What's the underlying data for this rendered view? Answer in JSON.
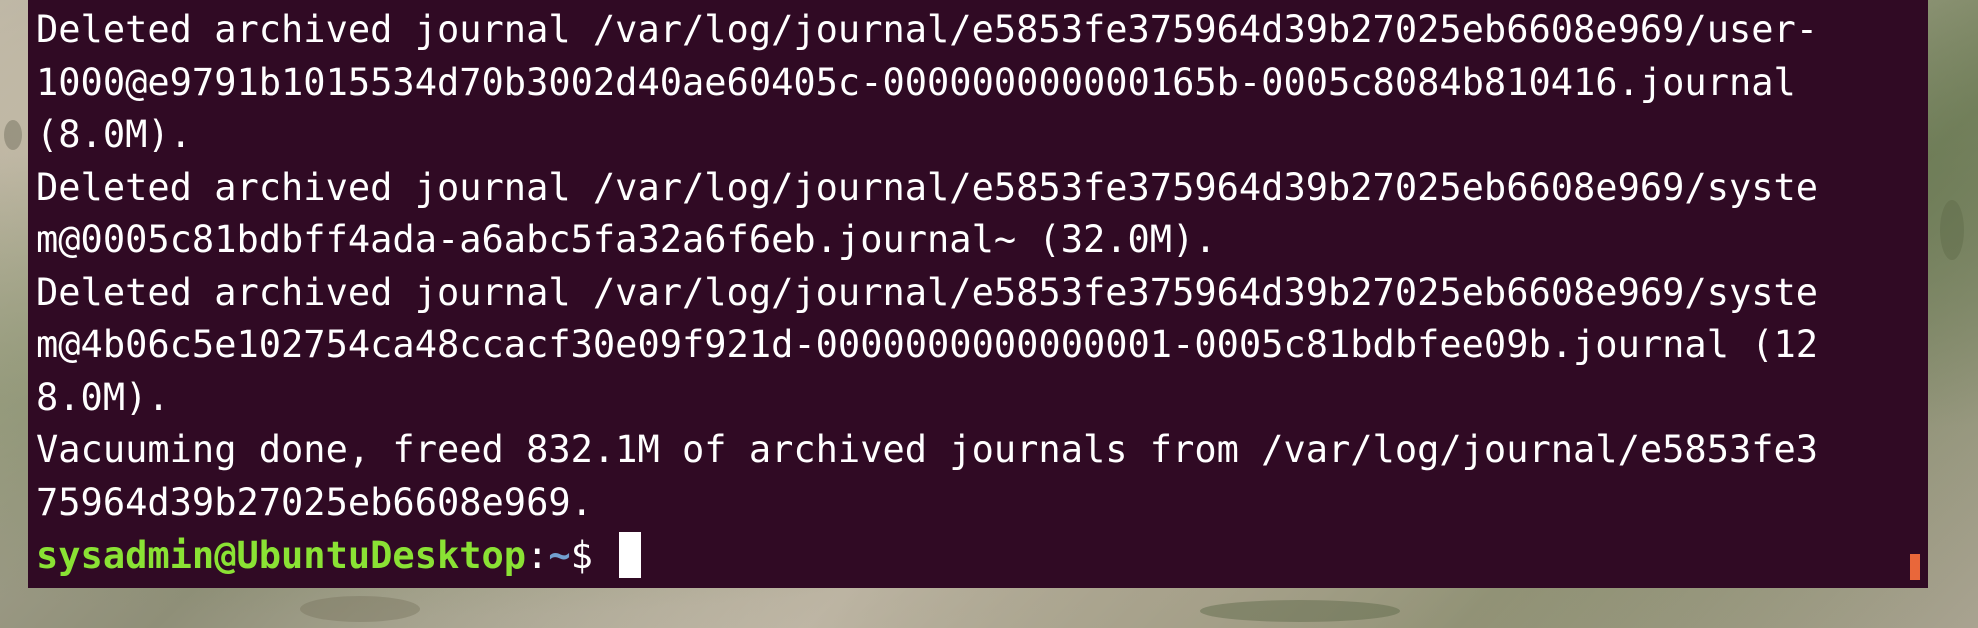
{
  "terminal": {
    "lines": [
      "Deleted archived journal /var/log/journal/e5853fe375964d39b27025eb6608e969/user-",
      "1000@e9791b1015534d70b3002d40ae60405c-000000000000165b-0005c8084b810416.journal",
      "(8.0M).",
      "Deleted archived journal /var/log/journal/e5853fe375964d39b27025eb6608e969/syste",
      "m@0005c81bdbff4ada-a6abc5fa32a6f6eb.journal~ (32.0M).",
      "Deleted archived journal /var/log/journal/e5853fe375964d39b27025eb6608e969/syste",
      "m@4b06c5e102754ca48ccacf30e09f921d-0000000000000001-0005c81bdbfee09b.journal (12",
      "8.0M).",
      "Vacuuming done, freed 832.1M of archived journals from /var/log/journal/e5853fe3",
      "75964d39b27025eb6608e969."
    ],
    "prompt": {
      "user_host": "sysadmin@UbuntuDesktop",
      "separator": ":",
      "path": "~",
      "symbol": "$ "
    }
  },
  "colors": {
    "terminal_background": "#300a24",
    "text": "#ffffff",
    "prompt_user": "#8ae234",
    "prompt_path": "#729fcf",
    "scroll_marker": "#e9673a"
  }
}
